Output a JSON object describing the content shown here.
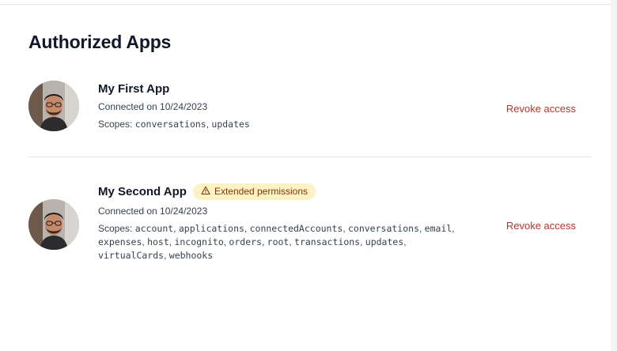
{
  "page": {
    "title": "Authorized Apps"
  },
  "apps": [
    {
      "name": "My First App",
      "badge": "",
      "connected": "Connected on 10/24/2023",
      "scopes_label": "Scopes:",
      "scopes": [
        "conversations",
        "updates"
      ],
      "revoke_label": "Revoke access"
    },
    {
      "name": "My Second App",
      "badge": "Extended permissions",
      "badge_icon": "warning-triangle-icon",
      "connected": "Connected on 10/24/2023",
      "scopes_label": "Scopes:",
      "scopes": [
        "account",
        "applications",
        "connectedAccounts",
        "conversations",
        "email",
        "expenses",
        "host",
        "incognito",
        "orders",
        "root",
        "transactions",
        "updates",
        "virtualCards",
        "webhooks"
      ],
      "revoke_label": "Revoke access"
    }
  ],
  "colors": {
    "revoke": "#b4362f",
    "badge_bg": "#fdf2c4",
    "badge_text": "#7c3a0a"
  }
}
